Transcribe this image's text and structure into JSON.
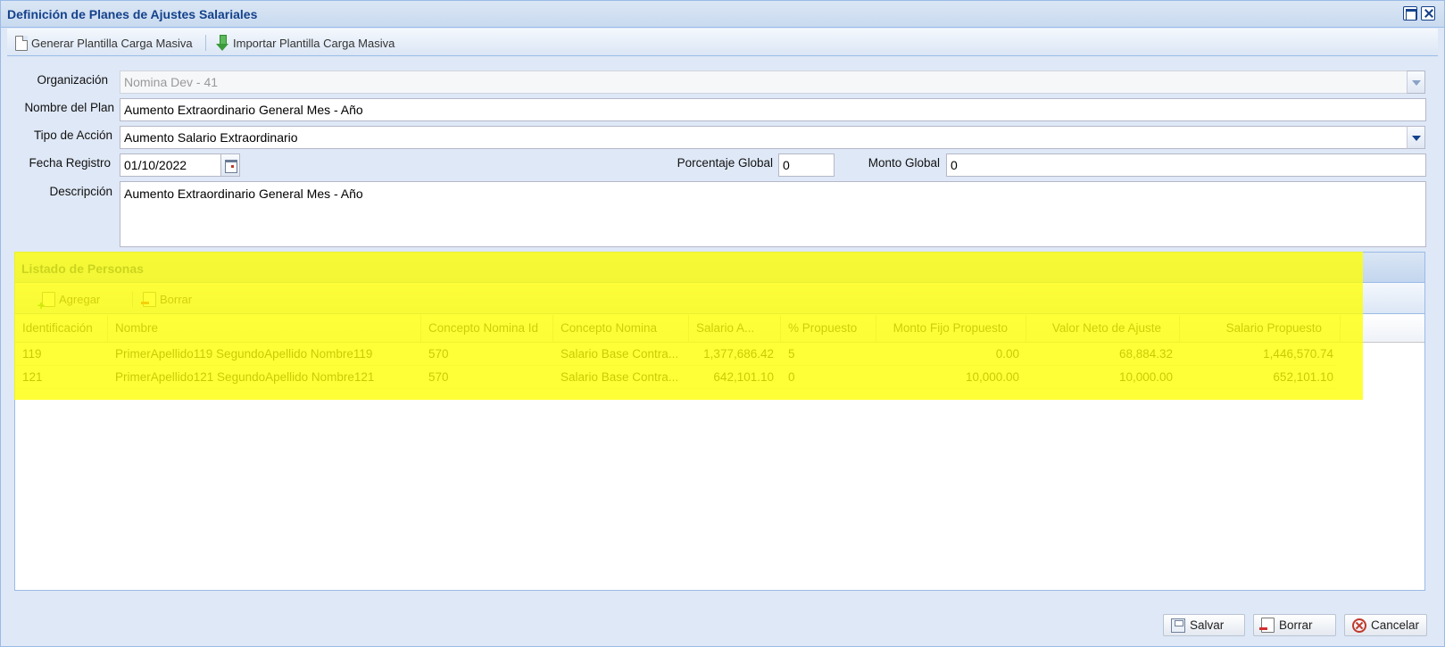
{
  "window": {
    "title": "Definición de Planes de Ajustes Salariales"
  },
  "toolbar": {
    "generate_label": "Generar Plantilla Carga Masiva",
    "import_label": "Importar Plantilla Carga Masiva"
  },
  "form": {
    "organizacion_label": "Organización",
    "organizacion_value": "Nomina Dev - 41",
    "nombre_plan_label": "Nombre del Plan",
    "nombre_plan_value": "Aumento Extraordinario General Mes - Año",
    "tipo_accion_label": "Tipo de Acción",
    "tipo_accion_value": "Aumento Salario Extraordinario",
    "fecha_registro_label": "Fecha Registro",
    "fecha_registro_value": "01/10/2022",
    "porcentaje_global_label": "Porcentaje Global",
    "porcentaje_global_value": "0",
    "monto_global_label": "Monto Global",
    "monto_global_value": "0",
    "descripcion_label": "Descripción",
    "descripcion_value": "Aumento Extraordinario General Mes - Año"
  },
  "grid": {
    "title": "Listado de Personas",
    "add_label": "Agregar",
    "delete_label": "Borrar",
    "columns": [
      "Identificación",
      "Nombre",
      "Concepto Nomina Id",
      "Concepto Nomina",
      "Salario A...",
      "% Propuesto",
      "Monto Fijo Propuesto",
      "Valor Neto de Ajuste",
      "Salario Propuesto"
    ],
    "rows": [
      [
        "119",
        "PrimerApellido119 SegundoApellido Nombre119",
        "570",
        "Salario Base Contra...",
        "1,377,686.42",
        "5",
        "0.00",
        "68,884.32",
        "1,446,570.74"
      ],
      [
        "121",
        "PrimerApellido121 SegundoApellido Nombre121",
        "570",
        "Salario Base Contra...",
        "642,101.10",
        "0",
        "10,000.00",
        "10,000.00",
        "652,101.10"
      ]
    ]
  },
  "footer": {
    "save_label": "Salvar",
    "delete_label": "Borrar",
    "cancel_label": "Cancelar"
  },
  "colors": {
    "title_blue": "#15428b",
    "window_bg": "#dfe8f6",
    "highlight": "#ffff00"
  }
}
